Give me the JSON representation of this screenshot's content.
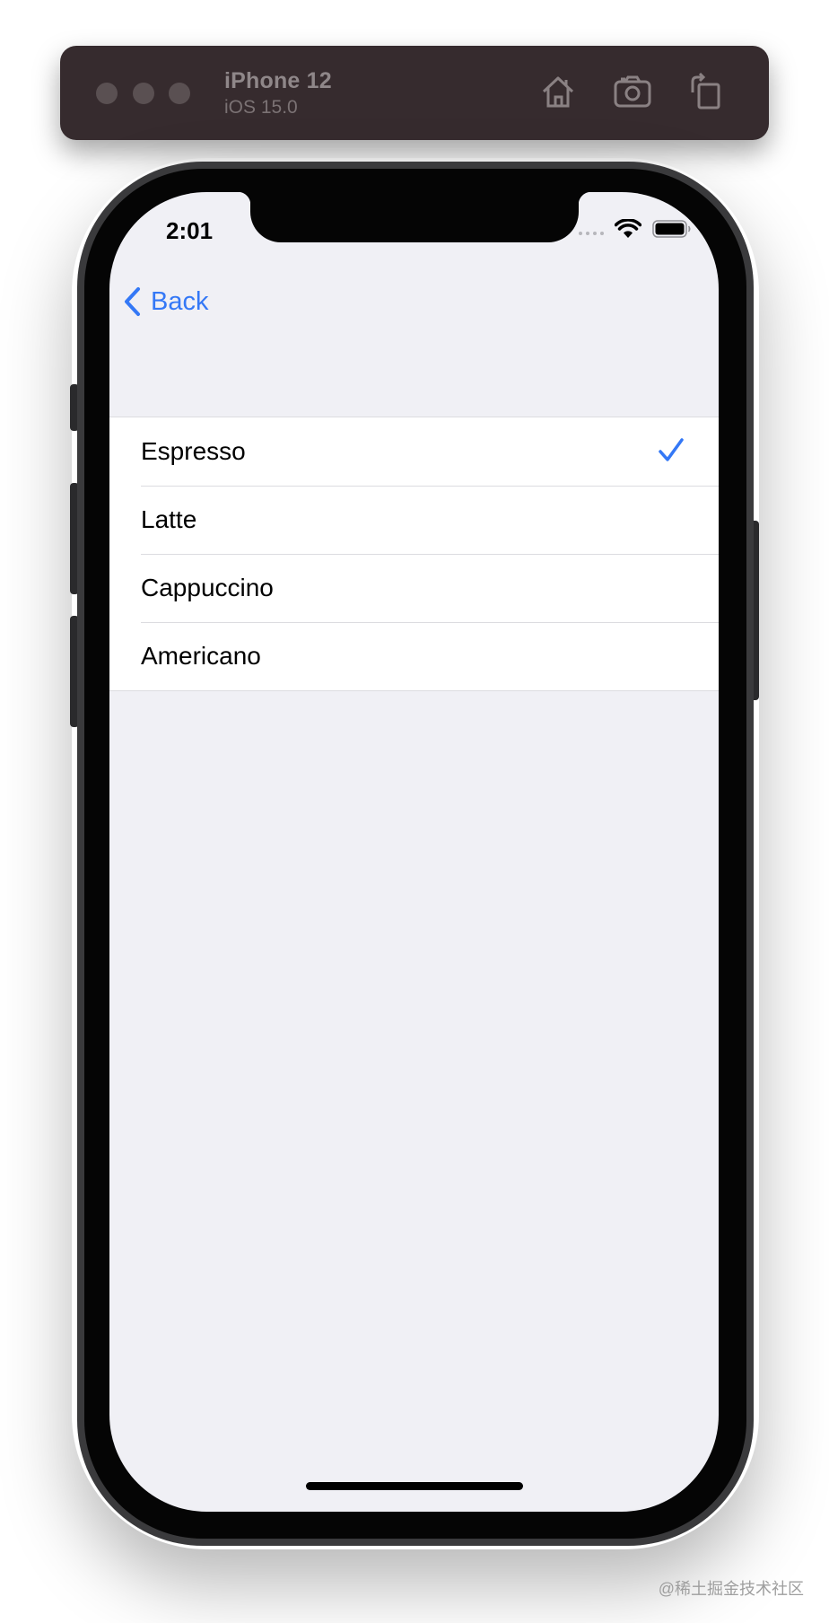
{
  "simulator": {
    "device_name": "iPhone 12",
    "os_version": "iOS 15.0",
    "icons": {
      "home": "home-icon",
      "screenshot": "camera-icon",
      "rotate": "rotate-icon"
    }
  },
  "status_bar": {
    "time": "2:01"
  },
  "nav": {
    "back_label": "Back"
  },
  "list": {
    "items": [
      {
        "label": "Espresso",
        "selected": true
      },
      {
        "label": "Latte",
        "selected": false
      },
      {
        "label": "Cappuccino",
        "selected": false
      },
      {
        "label": "Americano",
        "selected": false
      }
    ]
  },
  "watermark": "@稀土掘金技术社区",
  "colors": {
    "accent": "#3478f6",
    "background": "#f0f0f5",
    "toolbar": "#362b2e"
  }
}
